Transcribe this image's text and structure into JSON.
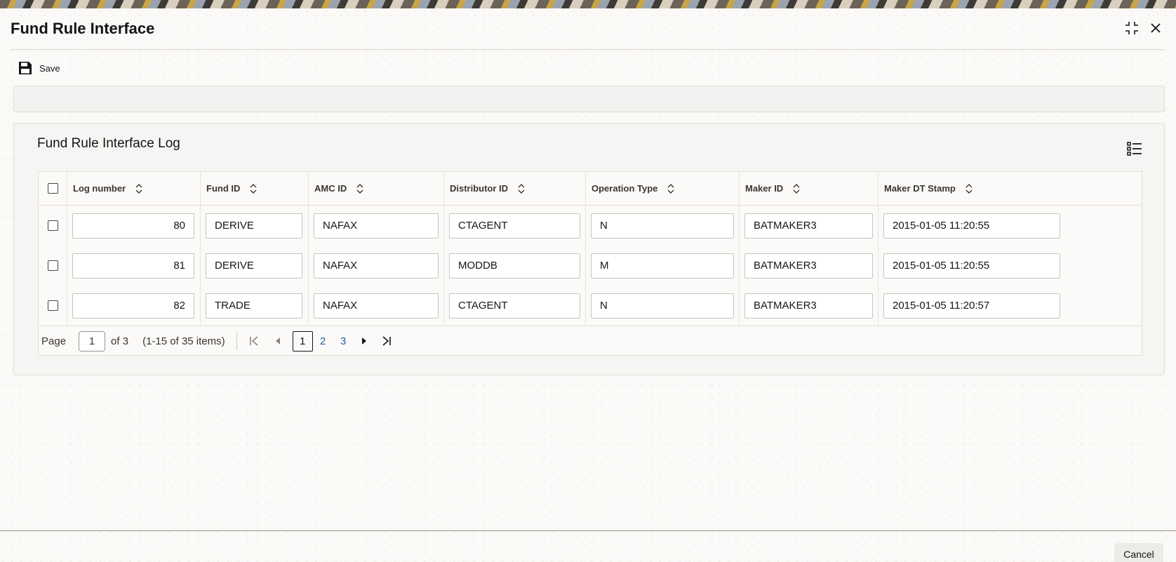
{
  "window": {
    "title": "Fund Rule Interface"
  },
  "toolbar": {
    "save_label": "Save"
  },
  "log_section": {
    "title": "Fund Rule Interface Log",
    "columns": [
      "Log number",
      "Fund ID",
      "AMC ID",
      "Distributor ID",
      "Operation Type",
      "Maker ID",
      "Maker DT Stamp"
    ],
    "rows": [
      {
        "log_number": "80",
        "fund_id": "DERIVE",
        "amc_id": "NAFAX",
        "distributor_id": "CTAGENT",
        "operation_type": "N",
        "maker_id": "BATMAKER3",
        "maker_dt_stamp": "2015-01-05 11:20:55"
      },
      {
        "log_number": "81",
        "fund_id": "DERIVE",
        "amc_id": "NAFAX",
        "distributor_id": "MODDB",
        "operation_type": "M",
        "maker_id": "BATMAKER3",
        "maker_dt_stamp": "2015-01-05 11:20:55"
      },
      {
        "log_number": "82",
        "fund_id": "TRADE",
        "amc_id": "NAFAX",
        "distributor_id": "CTAGENT",
        "operation_type": "N",
        "maker_id": "BATMAKER3",
        "maker_dt_stamp": "2015-01-05 11:20:57"
      }
    ],
    "pagination": {
      "page_label": "Page",
      "current_page": "1",
      "of_label": "of 3",
      "items_label": "(1-15 of 35 items)",
      "pages": [
        "1",
        "2",
        "3"
      ]
    }
  },
  "footer": {
    "cancel_label": "Cancel"
  },
  "icons": {
    "save": "save-icon",
    "minimize": "minimize-icon",
    "close": "close-icon",
    "list_view": "list-view-icon",
    "sort": "sort-icon"
  },
  "colors": {
    "link": "#1e5ea0",
    "text": "#161513",
    "border": "#c9c5bf"
  }
}
